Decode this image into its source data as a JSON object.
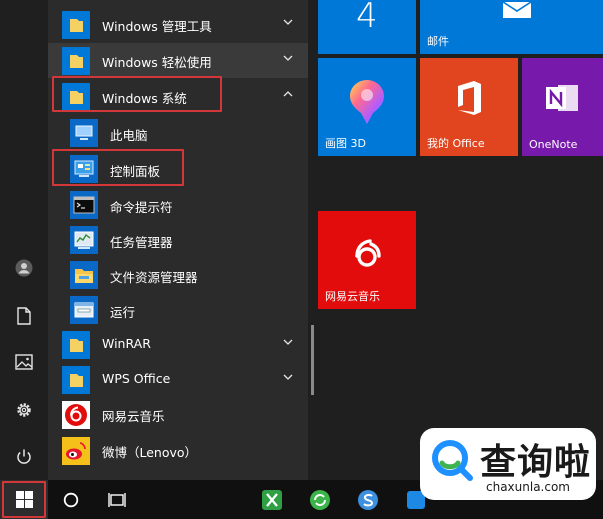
{
  "start_menu": {
    "app_list": [
      {
        "label": "Windows 管理工具",
        "kind": "folder",
        "expanded": false
      },
      {
        "label": "Windows 轻松使用",
        "kind": "folder",
        "expanded": false
      },
      {
        "label": "Windows 系统",
        "kind": "folder",
        "expanded": true
      },
      {
        "label": "此电脑",
        "kind": "child"
      },
      {
        "label": "控制面板",
        "kind": "child"
      },
      {
        "label": "命令提示符",
        "kind": "child"
      },
      {
        "label": "任务管理器",
        "kind": "child"
      },
      {
        "label": "文件资源管理器",
        "kind": "child"
      },
      {
        "label": "运行",
        "kind": "child"
      },
      {
        "label": "WinRAR",
        "kind": "folder",
        "expanded": false
      },
      {
        "label": "WPS Office",
        "kind": "folder",
        "expanded": false
      },
      {
        "label": "网易云音乐",
        "kind": "app"
      },
      {
        "label": "微博（Lenovo）",
        "kind": "app"
      }
    ],
    "tiles": [
      {
        "label": "",
        "value": "4",
        "color": "#0078d7",
        "icon": "calendar-icon"
      },
      {
        "label": "邮件",
        "color": "#0078d7",
        "icon": "mail-icon"
      },
      {
        "label": "画图 3D",
        "color": "#0078d7",
        "icon": "paint3d-icon"
      },
      {
        "label": "我的 Office",
        "color": "#e0451f",
        "icon": "office-icon"
      },
      {
        "label": "OneNote",
        "color": "#7719aa",
        "icon": "onenote-icon"
      },
      {
        "label": "网易云音乐",
        "color": "#e20c0c",
        "icon": "netease-music-icon"
      }
    ],
    "left_rail": [
      "user-icon",
      "documents-icon",
      "pictures-icon",
      "settings-icon",
      "power-icon"
    ]
  },
  "taskbar": {
    "items": [
      "start-button",
      "cortana-circle-icon",
      "task-view-icon",
      "app-green-icon",
      "app-refresh-icon",
      "app-s-icon",
      "app-blue-icon"
    ]
  },
  "watermark": {
    "text": "查询啦",
    "url": "chaxunla.com"
  },
  "colors": {
    "accent": "#0078d7",
    "highlight_box": "#d2373a",
    "list_bg": "#2b2b2b"
  }
}
